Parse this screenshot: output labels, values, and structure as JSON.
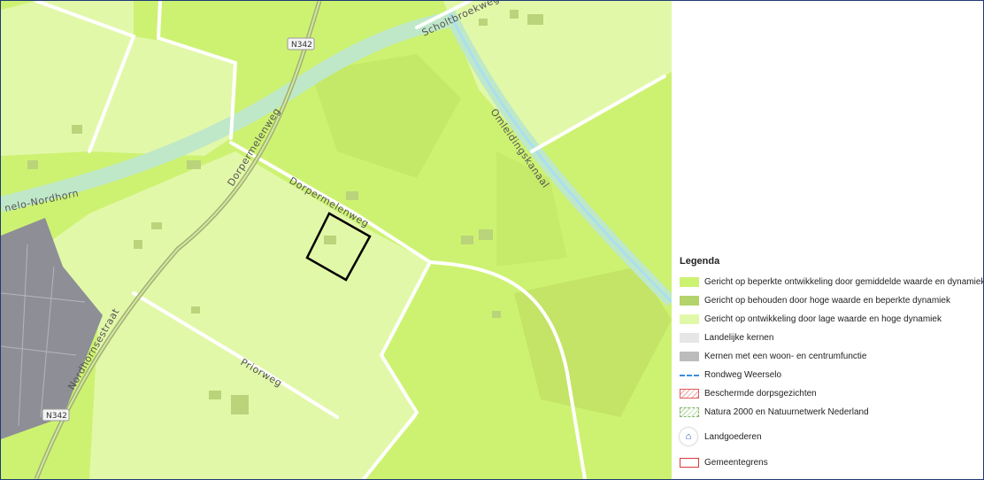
{
  "map": {
    "road_labels": {
      "scholtbroekweg": "Scholtbroekweg",
      "dorpermeienweg_ne": "Dorpermelenweg",
      "dorpermeienweg_e": "Dorpermelenweg",
      "nordhorn": "nelo-Nordhorn",
      "omleidingskanaal": "Omleidingskanaal",
      "nordhornsestraat": "Nordhornsestraat",
      "priorweg": "Priorweg"
    },
    "shields": {
      "top": "N342",
      "bottom": "N342"
    },
    "colors": {
      "medium": "#cdf272",
      "low": "#e2f8a9",
      "high": "#b7d66e",
      "canal": "#bfe8c9",
      "built": "#8e8e96",
      "road": "#ffffff"
    }
  },
  "legend": {
    "title": "Legenda",
    "items": [
      {
        "label": "Gericht op beperkte ontwikkeling door gemiddelde waarde en dynamiek",
        "color": "#cdf272"
      },
      {
        "label": "Gericht op behouden door hoge waarde en beperkte dynamiek",
        "color": "#b4d36b"
      },
      {
        "label": "Gericht op ontwikkeling door lage waarde en hoge dynamiek",
        "color": "#e2f8a9"
      },
      {
        "label": "Landelijke kernen",
        "color": "#e6e6e6"
      },
      {
        "label": "Kernen met een woon- en centrumfunctie",
        "color": "#bcbcbc"
      },
      {
        "label": "Rondweg Weerselo",
        "color": "#3a8de0"
      },
      {
        "label": "Beschermde dorpsgezichten",
        "color": "#e05a5a"
      },
      {
        "label": "Natura 2000 en Natuurnetwerk Nederland",
        "color": "#7fb26a"
      },
      {
        "label": "Landgoederen",
        "icon": "house-icon"
      },
      {
        "label": "Gemeentegrens",
        "color": "#d63a3a"
      }
    ]
  }
}
